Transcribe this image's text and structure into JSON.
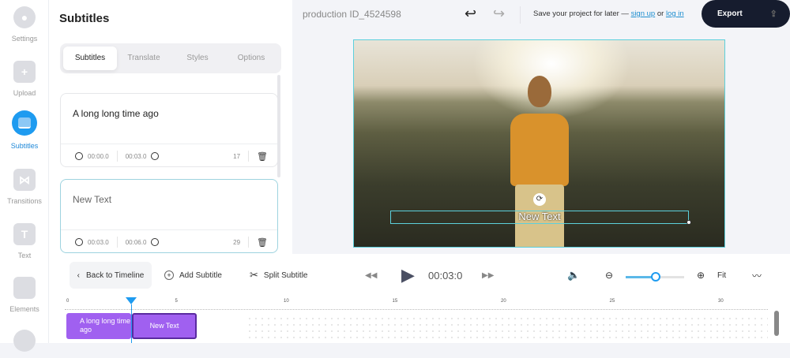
{
  "rail": [
    {
      "label": "Settings",
      "icon": "gear-icon"
    },
    {
      "label": "Upload",
      "icon": "plus-icon"
    },
    {
      "label": "Subtitles",
      "icon": "subtitles-icon",
      "active": true
    },
    {
      "label": "Transitions",
      "icon": "transitions-icon"
    },
    {
      "label": "Text",
      "icon": "text-icon",
      "glyph": "T"
    },
    {
      "label": "Elements",
      "icon": "elements-icon"
    }
  ],
  "panel": {
    "title": "Subtitles",
    "tabs": [
      "Subtitles",
      "Translate",
      "Styles",
      "Options"
    ],
    "cards": [
      {
        "text": "A long long time ago",
        "start": "00:00.0",
        "end": "00:03.0",
        "count": "17"
      },
      {
        "text": "New Text",
        "start": "00:03.0",
        "end": "00:06.0",
        "count": "29"
      }
    ]
  },
  "header": {
    "project": "production ID_4524598",
    "save_text": "Save your project for later —",
    "sign_up": "sign up",
    "or": "or",
    "log_in": "log in",
    "export": "Export"
  },
  "preview": {
    "subtitle": "New Text"
  },
  "toolbar": {
    "back": "Back to Timeline",
    "add": "Add Subtitle",
    "split": "Split Subtitle",
    "time": "00:03:0",
    "fit": "Fit",
    "zoom_level": 0.45
  },
  "timeline": {
    "ticks": [
      "0",
      "5",
      "10",
      "15",
      "20",
      "25",
      "30"
    ],
    "clips": [
      {
        "text": "A long long time ago"
      },
      {
        "text": "New Text"
      }
    ]
  },
  "colors": {
    "accent": "#1e9bf0",
    "export_bg": "#161c2e",
    "clip": "#a060f0"
  }
}
